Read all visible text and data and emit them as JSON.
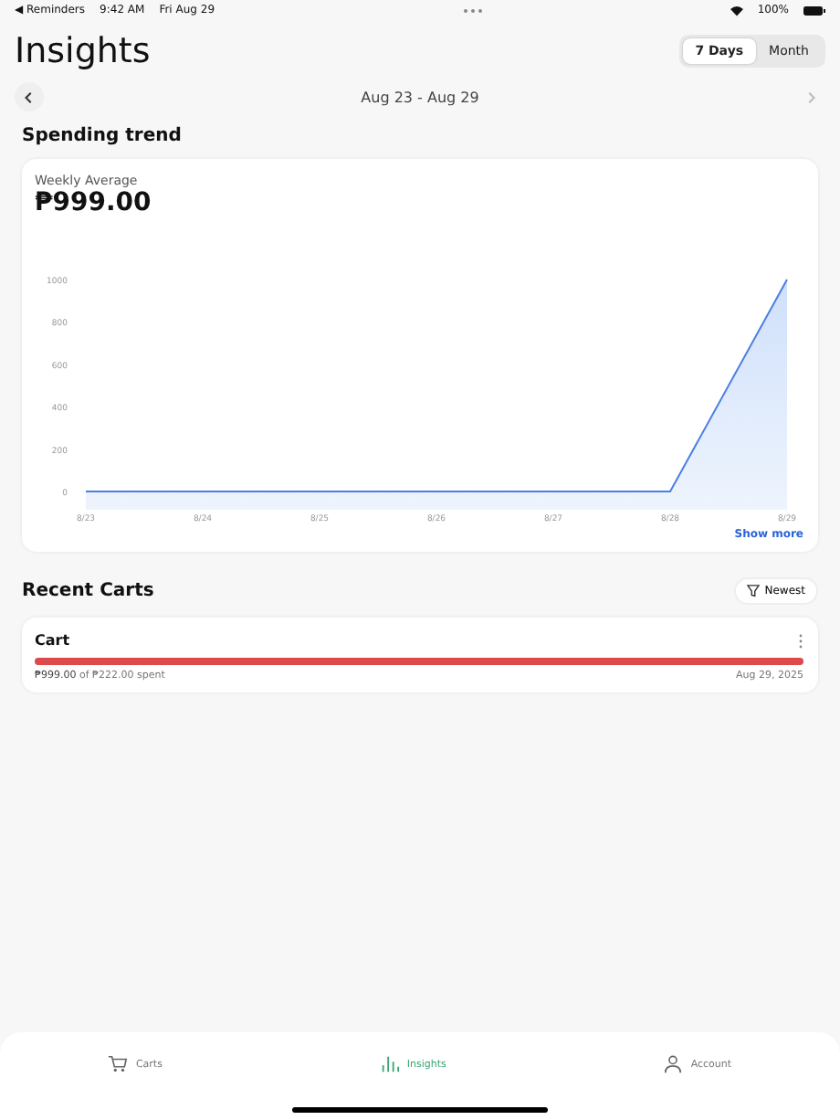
{
  "status_bar": {
    "back_app": "◀ Reminders",
    "time": "9:42 AM",
    "date": "Fri Aug 29",
    "battery": "100%"
  },
  "header": {
    "title": "Insights",
    "segments": [
      {
        "label": "7 Days",
        "selected": true
      },
      {
        "label": "Month",
        "selected": false
      }
    ]
  },
  "date_nav": {
    "range": "Aug 23 - Aug 29",
    "prev_disabled": false,
    "next_disabled": true
  },
  "spending_trend": {
    "heading": "Spending trend",
    "average_label": "Weekly Average",
    "average_value": "₱999.00",
    "show_more": "Show more",
    "chart_data": {
      "type": "area",
      "categories": [
        "8/23",
        "8/24",
        "8/25",
        "8/26",
        "8/27",
        "8/28",
        "8/29"
      ],
      "series": [
        {
          "color": "#4a7fe0",
          "values": [
            0,
            0,
            0,
            0,
            0,
            0,
            1000
          ]
        }
      ],
      "ylim": [
        0,
        1000
      ],
      "yticks": [
        0,
        200,
        400,
        600,
        800,
        1000
      ]
    }
  },
  "recent_carts": {
    "heading": "Recent Carts",
    "sort": "Newest",
    "carts": [
      {
        "name": "Cart",
        "level": 1,
        "spent": "₱999.00",
        "budget": "of ₱222.00 spent",
        "date": "Aug 29, 2025"
      }
    ]
  },
  "tab_bar": [
    {
      "label": "Carts",
      "kind": "cart",
      "selected": false
    },
    {
      "label": "Insights",
      "kind": "chart",
      "selected": true
    },
    {
      "label": "Account",
      "kind": "person",
      "selected": false
    }
  ]
}
